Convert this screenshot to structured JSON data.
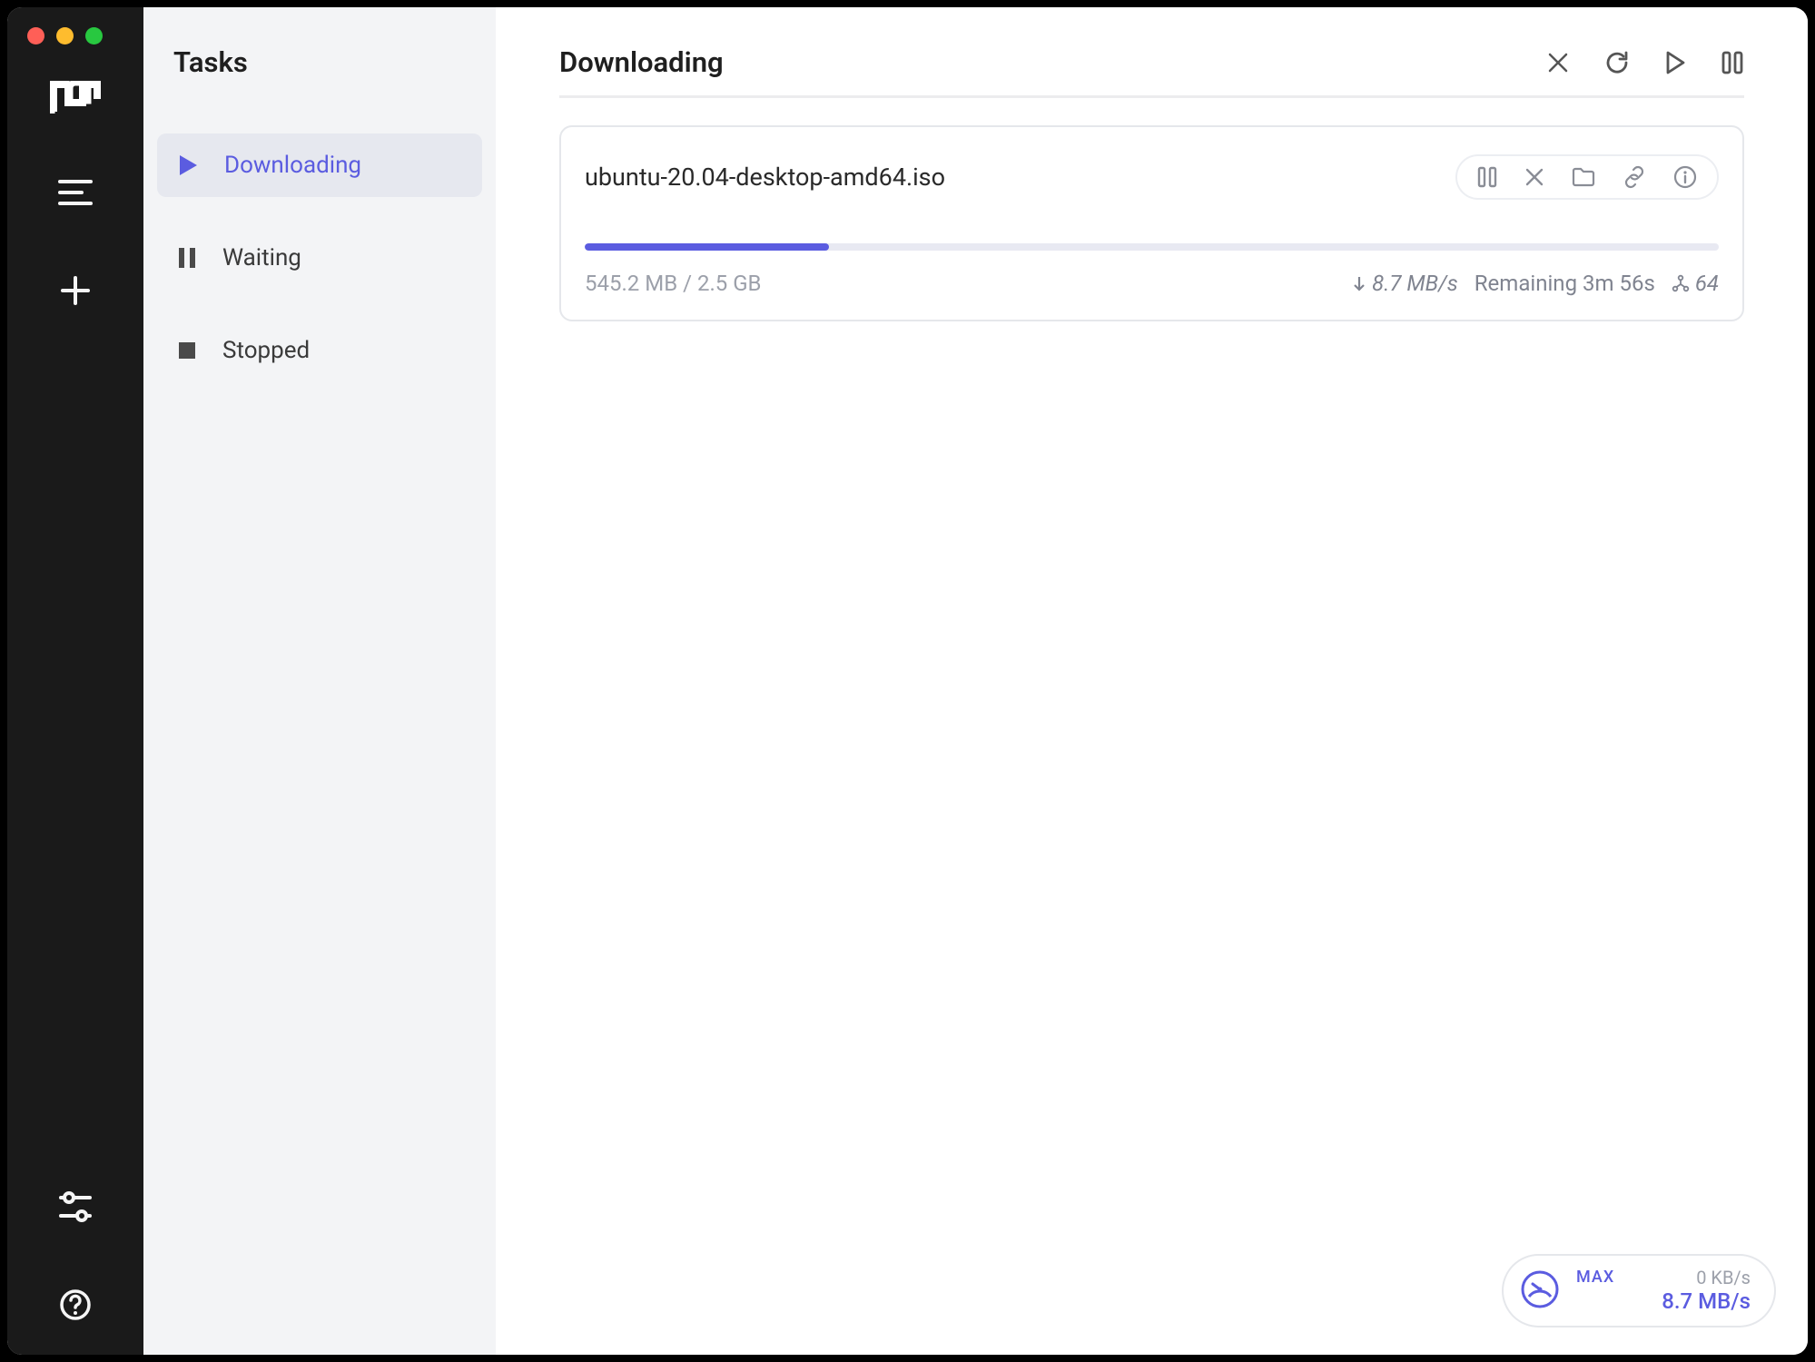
{
  "sidebar": {
    "title": "Tasks",
    "categories": [
      {
        "label": "Downloading",
        "icon": "play",
        "active": true
      },
      {
        "label": "Waiting",
        "icon": "pause",
        "active": false
      },
      {
        "label": "Stopped",
        "icon": "stop",
        "active": false
      }
    ]
  },
  "main": {
    "title": "Downloading",
    "task": {
      "name": "ubuntu-20.04-desktop-amd64.iso",
      "sizes": "545.2 MB / 2.5 GB",
      "progress_percent": 21.5,
      "speed": "8.7 MB/s",
      "remaining": "Remaining 3m 56s",
      "peers": "64"
    }
  },
  "speed_pill": {
    "label_max": "MAX",
    "upload": "0 KB/s",
    "download": "8.7 MB/s"
  }
}
